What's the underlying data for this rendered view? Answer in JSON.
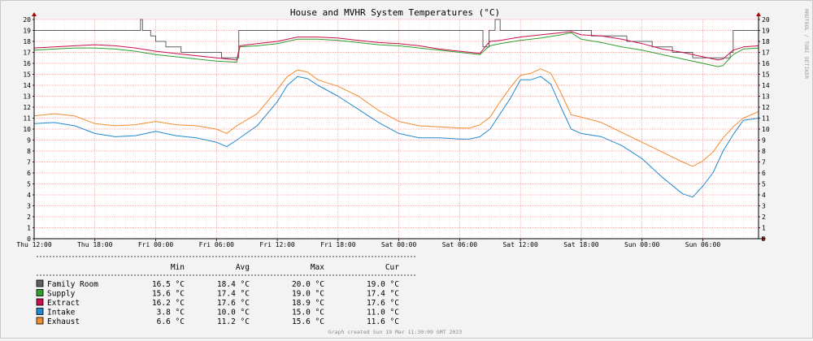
{
  "chart_data": {
    "type": "line",
    "title": "House and MVHR System Temperatures (°C)",
    "side_label": "RRDTOOL / TOBI OETIKER",
    "credit": "Graph created Sun 19 Mar 11:30:09 GMT 2023",
    "ylim": [
      0,
      20
    ],
    "y_ticks": [
      0,
      1,
      2,
      3,
      4,
      5,
      6,
      7,
      8,
      9,
      10,
      11,
      12,
      13,
      14,
      15,
      16,
      17,
      18,
      19,
      20
    ],
    "x_unit": "hours since Thu 12:00",
    "xlim": [
      0,
      71.5
    ],
    "x_ticks": [
      {
        "x": 0,
        "label": "Thu 12:00"
      },
      {
        "x": 6,
        "label": "Thu 18:00"
      },
      {
        "x": 12,
        "label": "Fri 00:00"
      },
      {
        "x": 18,
        "label": "Fri 06:00"
      },
      {
        "x": 24,
        "label": "Fri 12:00"
      },
      {
        "x": 30,
        "label": "Fri 18:00"
      },
      {
        "x": 36,
        "label": "Sat 00:00"
      },
      {
        "x": 42,
        "label": "Sat 06:00"
      },
      {
        "x": 48,
        "label": "Sat 12:00"
      },
      {
        "x": 54,
        "label": "Sat 18:00"
      },
      {
        "x": 60,
        "label": "Sun 00:00"
      },
      {
        "x": 66,
        "label": "Sun 06:00"
      }
    ],
    "grid": true,
    "legend_headers": {
      "min": "Min",
      "avg": "Avg",
      "max": "Max",
      "cur": "Cur"
    },
    "series": [
      {
        "name": "Family Room",
        "color": "#606060",
        "step": true,
        "stats": {
          "min": "16.5 °C",
          "avg": "18.4 °C",
          "max": "20.0 °C",
          "cur": "19.0 °C"
        },
        "points": [
          [
            0,
            19
          ],
          [
            10.5,
            19
          ],
          [
            10.5,
            20
          ],
          [
            10.7,
            20
          ],
          [
            10.7,
            19
          ],
          [
            11.5,
            19
          ],
          [
            11.5,
            18.5
          ],
          [
            12,
            18.5
          ],
          [
            12,
            18
          ],
          [
            13,
            18
          ],
          [
            13,
            17.5
          ],
          [
            14.5,
            17.5
          ],
          [
            14.5,
            17
          ],
          [
            18.5,
            17
          ],
          [
            18.5,
            16.5
          ],
          [
            20.2,
            16.5
          ],
          [
            20.2,
            19
          ],
          [
            44.3,
            19
          ],
          [
            44.3,
            17.5
          ],
          [
            44.9,
            17.5
          ],
          [
            44.9,
            19
          ],
          [
            45.5,
            19
          ],
          [
            45.5,
            20
          ],
          [
            46,
            20
          ],
          [
            46,
            19
          ],
          [
            55,
            19
          ],
          [
            55,
            18.5
          ],
          [
            58.5,
            18.5
          ],
          [
            58.5,
            18
          ],
          [
            61,
            18
          ],
          [
            61,
            17.5
          ],
          [
            63,
            17.5
          ],
          [
            63,
            17
          ],
          [
            65,
            17
          ],
          [
            65,
            16.5
          ],
          [
            68.7,
            16.5
          ],
          [
            68.7,
            17
          ],
          [
            69,
            17
          ],
          [
            69,
            19
          ],
          [
            71.5,
            19
          ]
        ]
      },
      {
        "name": "Supply",
        "color": "#2da02d",
        "step": false,
        "stats": {
          "min": "15.6 °C",
          "avg": "17.4 °C",
          "max": "19.0 °C",
          "cur": "17.4 °C"
        },
        "points": [
          [
            0,
            17.2
          ],
          [
            2,
            17.3
          ],
          [
            4,
            17.4
          ],
          [
            6,
            17.4
          ],
          [
            8,
            17.3
          ],
          [
            10,
            17.1
          ],
          [
            12,
            16.8
          ],
          [
            15,
            16.5
          ],
          [
            18,
            16.2
          ],
          [
            20,
            16.1
          ],
          [
            20.3,
            17.5
          ],
          [
            22,
            17.6
          ],
          [
            24,
            17.8
          ],
          [
            26,
            18.2
          ],
          [
            28,
            18.2
          ],
          [
            30,
            18.1
          ],
          [
            32,
            17.9
          ],
          [
            34,
            17.7
          ],
          [
            36,
            17.6
          ],
          [
            38,
            17.4
          ],
          [
            40,
            17.2
          ],
          [
            42,
            17
          ],
          [
            44,
            16.8
          ],
          [
            44.6,
            17.3
          ],
          [
            45,
            17.6
          ],
          [
            46,
            17.8
          ],
          [
            48,
            18.1
          ],
          [
            50,
            18.3
          ],
          [
            52,
            18.6
          ],
          [
            53,
            18.8
          ],
          [
            54,
            18.2
          ],
          [
            56,
            17.9
          ],
          [
            58,
            17.5
          ],
          [
            60,
            17.2
          ],
          [
            62,
            16.8
          ],
          [
            64,
            16.4
          ],
          [
            66,
            16
          ],
          [
            67.5,
            15.7
          ],
          [
            68,
            15.8
          ],
          [
            69,
            16.8
          ],
          [
            70,
            17.3
          ],
          [
            71.5,
            17.4
          ]
        ]
      },
      {
        "name": "Extract",
        "color": "#c8104a",
        "step": false,
        "stats": {
          "min": "16.2 °C",
          "avg": "17.6 °C",
          "max": "18.9 °C",
          "cur": "17.6 °C"
        },
        "points": [
          [
            0,
            17.4
          ],
          [
            2,
            17.5
          ],
          [
            4,
            17.6
          ],
          [
            6,
            17.7
          ],
          [
            8,
            17.6
          ],
          [
            10,
            17.4
          ],
          [
            12,
            17.1
          ],
          [
            15,
            16.8
          ],
          [
            18,
            16.5
          ],
          [
            20,
            16.3
          ],
          [
            20.3,
            17.6
          ],
          [
            22,
            17.8
          ],
          [
            24,
            18
          ],
          [
            26,
            18.4
          ],
          [
            28,
            18.4
          ],
          [
            30,
            18.3
          ],
          [
            32,
            18.1
          ],
          [
            34,
            17.9
          ],
          [
            36,
            17.8
          ],
          [
            38,
            17.6
          ],
          [
            40,
            17.3
          ],
          [
            42,
            17.1
          ],
          [
            44,
            16.9
          ],
          [
            44.6,
            17.6
          ],
          [
            45,
            18
          ],
          [
            46,
            18.1
          ],
          [
            48,
            18.4
          ],
          [
            50,
            18.6
          ],
          [
            52,
            18.8
          ],
          [
            53,
            18.9
          ],
          [
            54,
            18.6
          ],
          [
            56,
            18.5
          ],
          [
            58,
            18.2
          ],
          [
            60,
            17.8
          ],
          [
            62,
            17.3
          ],
          [
            64,
            17
          ],
          [
            66,
            16.6
          ],
          [
            67.5,
            16.3
          ],
          [
            68,
            16.4
          ],
          [
            69,
            17.2
          ],
          [
            70,
            17.5
          ],
          [
            71.5,
            17.6
          ]
        ]
      },
      {
        "name": "Intake",
        "color": "#1f8ad0",
        "step": false,
        "stats": {
          "min": "3.8 °C",
          "avg": "10.0 °C",
          "max": "15.0 °C",
          "cur": "11.0 °C"
        },
        "points": [
          [
            0,
            10.5
          ],
          [
            2,
            10.6
          ],
          [
            4,
            10.3
          ],
          [
            6,
            9.6
          ],
          [
            8,
            9.3
          ],
          [
            10,
            9.4
          ],
          [
            12,
            9.8
          ],
          [
            14,
            9.4
          ],
          [
            16,
            9.2
          ],
          [
            18,
            8.8
          ],
          [
            19,
            8.4
          ],
          [
            20,
            9
          ],
          [
            22,
            10.3
          ],
          [
            24,
            12.5
          ],
          [
            25,
            14
          ],
          [
            26,
            14.8
          ],
          [
            27,
            14.6
          ],
          [
            28,
            14
          ],
          [
            30,
            13
          ],
          [
            32,
            11.8
          ],
          [
            34,
            10.6
          ],
          [
            36,
            9.6
          ],
          [
            38,
            9.2
          ],
          [
            40,
            9.2
          ],
          [
            42,
            9.1
          ],
          [
            43,
            9.1
          ],
          [
            44,
            9.3
          ],
          [
            45,
            10
          ],
          [
            46,
            11.4
          ],
          [
            47,
            12.8
          ],
          [
            48,
            14.5
          ],
          [
            49,
            14.5
          ],
          [
            50,
            14.8
          ],
          [
            51,
            14.1
          ],
          [
            52,
            12
          ],
          [
            53,
            10
          ],
          [
            54,
            9.6
          ],
          [
            56,
            9.3
          ],
          [
            58,
            8.5
          ],
          [
            60,
            7.3
          ],
          [
            62,
            5.6
          ],
          [
            64,
            4.1
          ],
          [
            65,
            3.8
          ],
          [
            66,
            4.8
          ],
          [
            67,
            6
          ],
          [
            68,
            8
          ],
          [
            69,
            9.5
          ],
          [
            70,
            10.8
          ],
          [
            71.5,
            11
          ]
        ]
      },
      {
        "name": "Exhaust",
        "color": "#f28b30",
        "step": false,
        "stats": {
          "min": "6.6 °C",
          "avg": "11.2 °C",
          "max": "15.6 °C",
          "cur": "11.6 °C"
        },
        "points": [
          [
            0,
            11.2
          ],
          [
            2,
            11.4
          ],
          [
            4,
            11.2
          ],
          [
            6,
            10.5
          ],
          [
            8,
            10.3
          ],
          [
            10,
            10.4
          ],
          [
            12,
            10.7
          ],
          [
            14,
            10.4
          ],
          [
            16,
            10.3
          ],
          [
            18,
            10
          ],
          [
            19,
            9.6
          ],
          [
            20,
            10.3
          ],
          [
            22,
            11.4
          ],
          [
            24,
            13.6
          ],
          [
            25,
            14.8
          ],
          [
            26,
            15.4
          ],
          [
            27,
            15.2
          ],
          [
            28,
            14.5
          ],
          [
            30,
            13.9
          ],
          [
            32,
            13
          ],
          [
            34,
            11.7
          ],
          [
            36,
            10.7
          ],
          [
            38,
            10.3
          ],
          [
            40,
            10.2
          ],
          [
            42,
            10.1
          ],
          [
            43,
            10.1
          ],
          [
            44,
            10.4
          ],
          [
            45,
            11.1
          ],
          [
            46,
            12.5
          ],
          [
            47,
            13.8
          ],
          [
            48,
            14.9
          ],
          [
            49,
            15.1
          ],
          [
            50,
            15.5
          ],
          [
            51,
            15.1
          ],
          [
            52,
            13.3
          ],
          [
            53,
            11.3
          ],
          [
            54,
            11.1
          ],
          [
            56,
            10.6
          ],
          [
            58,
            9.7
          ],
          [
            60,
            8.8
          ],
          [
            62,
            7.9
          ],
          [
            64,
            7
          ],
          [
            65,
            6.6
          ],
          [
            66,
            7.1
          ],
          [
            67,
            7.9
          ],
          [
            68,
            9.2
          ],
          [
            69,
            10.2
          ],
          [
            70,
            11
          ],
          [
            71.5,
            11.6
          ]
        ]
      }
    ]
  }
}
